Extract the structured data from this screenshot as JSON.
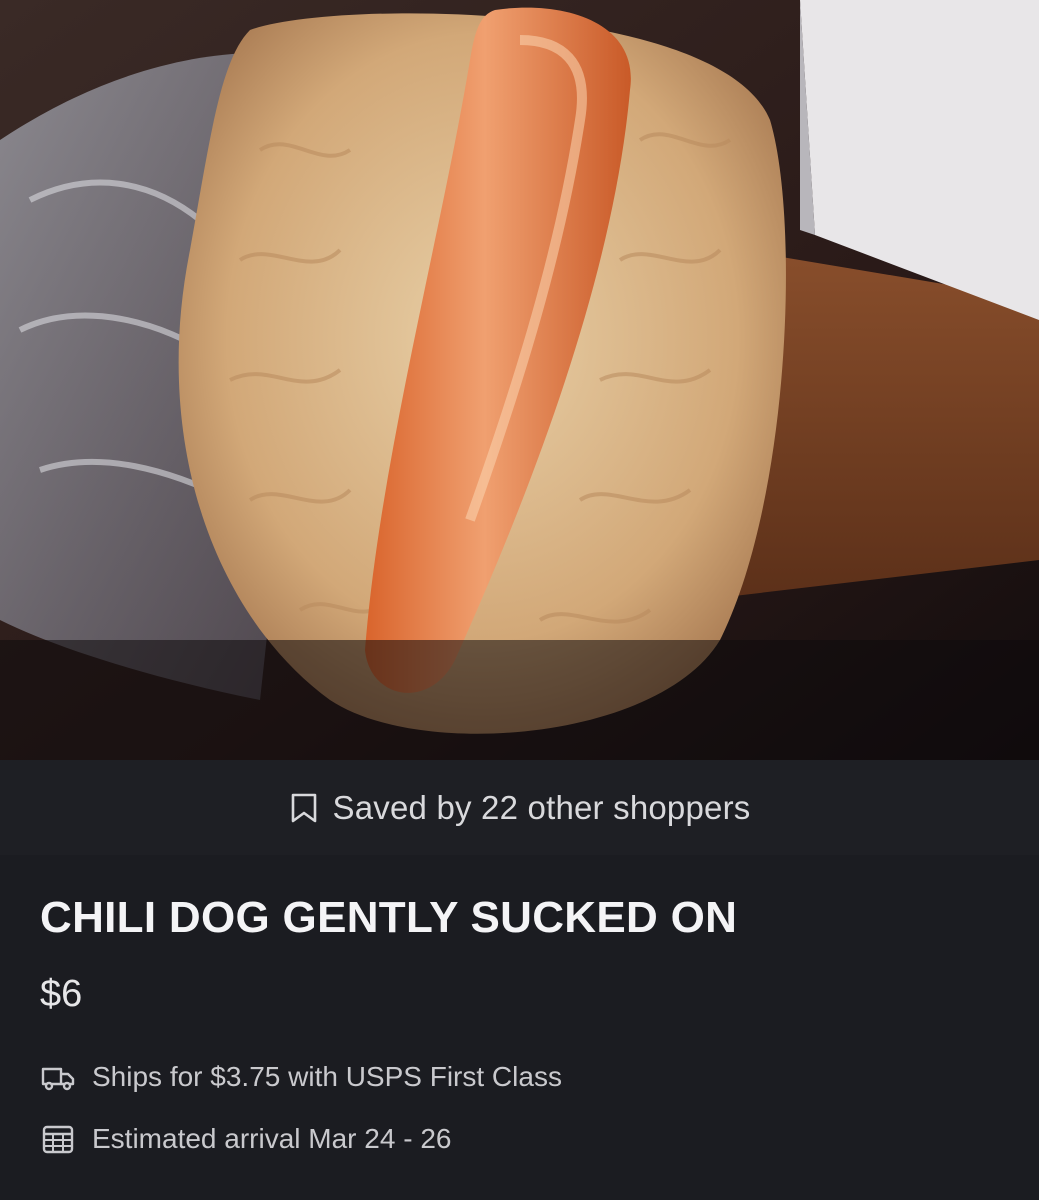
{
  "listing": {
    "saved_text": "Saved by 22 other shoppers",
    "title": "CHILI DOG GENTLY SUCKED ON",
    "price": "$6",
    "shipping": "Ships for $3.75 with USPS First Class",
    "arrival": "Estimated arrival Mar 24 - 26"
  },
  "icons": {
    "saved": "bookmark-icon",
    "shipping": "truck-icon",
    "arrival": "calendar-icon"
  },
  "colors": {
    "background": "#1b1c21",
    "saved_bar": "#1e1f24",
    "title_text": "#f4f4f6",
    "secondary_text": "#c9c9cd"
  }
}
